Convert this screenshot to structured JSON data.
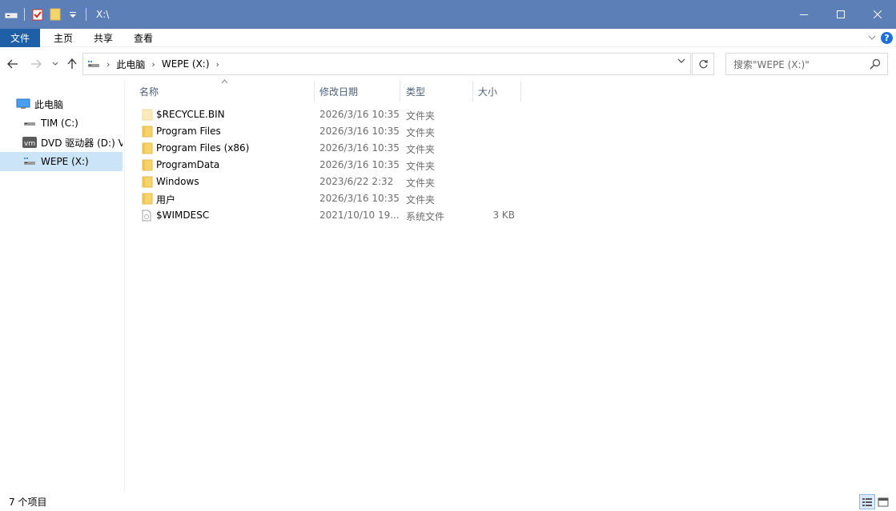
{
  "window": {
    "title": "X:\\",
    "minimize_icon": "minimize-icon",
    "maximize_icon": "maximize-icon",
    "close_icon": "close-icon"
  },
  "ribbon": {
    "tabs": [
      {
        "label": "文件"
      },
      {
        "label": "主页"
      },
      {
        "label": "共享"
      },
      {
        "label": "查看"
      }
    ]
  },
  "address": {
    "crumbs": [
      "此电脑",
      "WEPE (X:)"
    ]
  },
  "search": {
    "placeholder": "搜索\"WEPE (X:)\""
  },
  "sidebar": {
    "items": [
      {
        "label": "此电脑",
        "icon": "computer-icon"
      },
      {
        "label": "TIM (C:)",
        "icon": "drive-icon"
      },
      {
        "label": "DVD 驱动器 (D:) V",
        "icon": "vm-dvd-icon"
      },
      {
        "label": "WEPE (X:)",
        "icon": "drive-icon",
        "selected": true
      }
    ]
  },
  "columns": {
    "name": "名称",
    "date": "修改日期",
    "type": "类型",
    "size": "大小"
  },
  "files": [
    {
      "name": "$RECYCLE.BIN",
      "date": "2026/3/16 10:35",
      "type": "文件夹",
      "size": "",
      "icon": "folder-icon"
    },
    {
      "name": "Program Files",
      "date": "2026/3/16 10:35",
      "type": "文件夹",
      "size": "",
      "icon": "folder-icon"
    },
    {
      "name": "Program Files (x86)",
      "date": "2026/3/16 10:35",
      "type": "文件夹",
      "size": "",
      "icon": "folder-icon"
    },
    {
      "name": "ProgramData",
      "date": "2026/3/16 10:35",
      "type": "文件夹",
      "size": "",
      "icon": "folder-icon"
    },
    {
      "name": "Windows",
      "date": "2023/6/22 2:32",
      "type": "文件夹",
      "size": "",
      "icon": "folder-icon"
    },
    {
      "name": "用户",
      "date": "2026/3/16 10:35",
      "type": "文件夹",
      "size": "",
      "icon": "folder-icon"
    },
    {
      "name": "$WIMDESC",
      "date": "2021/10/10 19...",
      "type": "系统文件",
      "size": "3 KB",
      "icon": "system-file-icon"
    }
  ],
  "status": {
    "count": "7 个项目"
  },
  "colors": {
    "titlebar": "#5b7fb6",
    "file_tab": "#1e5fa8",
    "selection": "#cce4f7",
    "folder": "#f7d36b"
  }
}
